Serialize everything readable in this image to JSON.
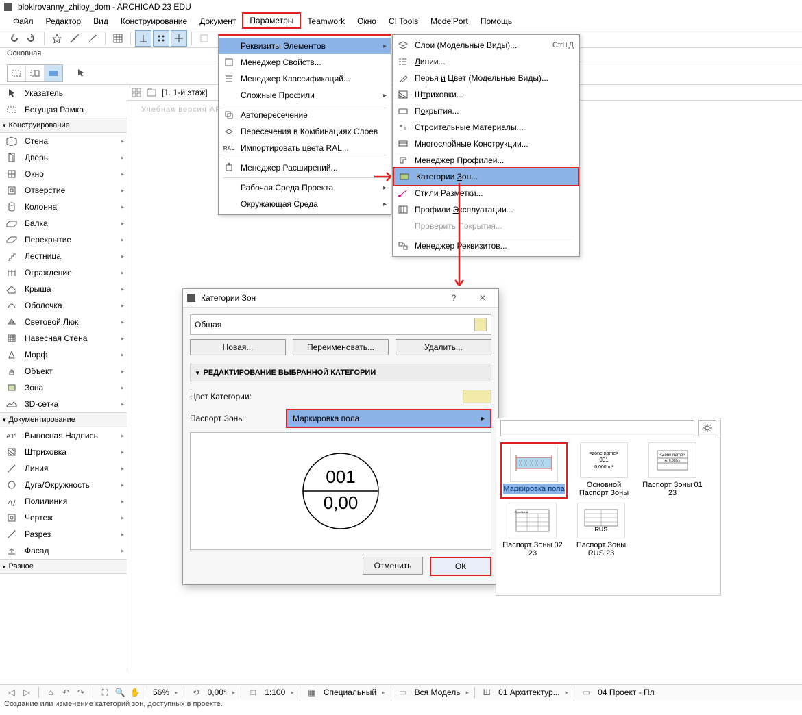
{
  "title": "blokirovanny_zhiloy_dom - ARCHICAD 23 EDU",
  "menubar": [
    "Файл",
    "Редактор",
    "Вид",
    "Конструирование",
    "Документ",
    "Параметры",
    "Teamwork",
    "Окно",
    "CI Tools",
    "ModelPort",
    "Помощь"
  ],
  "menubar_highlight_index": 5,
  "info_bar": "Основная",
  "tab_label": "[1. 1-й этаж]",
  "watermark": "Учебная версия ARCHI(",
  "dropdown": [
    {
      "label": "Реквизиты Элементов",
      "type": "sub",
      "hl": true
    },
    {
      "label": "Менеджер Свойств..."
    },
    {
      "label": "Менеджер Классификаций..."
    },
    {
      "label": "Сложные Профили",
      "type": "sub"
    },
    {
      "type": "sep"
    },
    {
      "label": "Автопересечение"
    },
    {
      "label": "Пересечения в Комбинациях Слоев"
    },
    {
      "label": "Импортировать цвета RAL..."
    },
    {
      "type": "sep"
    },
    {
      "label": "Менеджер Расширений..."
    },
    {
      "type": "sep"
    },
    {
      "label": "Рабочая Среда Проекта",
      "type": "sub"
    },
    {
      "label": "Окружающая Среда",
      "type": "sub"
    }
  ],
  "submenu": [
    {
      "label": "Слои (Модельные Виды)...",
      "accel": "Ctrl+Д"
    },
    {
      "label": "Линии..."
    },
    {
      "label": "Перья и Цвет (Модельные Виды)..."
    },
    {
      "label": "Штриховки..."
    },
    {
      "label": "Покрытия..."
    },
    {
      "label": "Строительные Материалы..."
    },
    {
      "label": "Многослойные Конструкции..."
    },
    {
      "label": "Менеджер Профилей..."
    },
    {
      "label": "Категории Зон...",
      "hl": true
    },
    {
      "label": "Стили Разметки..."
    },
    {
      "label": "Профили Эксплуатации..."
    },
    {
      "label": "Проверить Покрытия...",
      "disabled": true
    },
    {
      "type": "sep"
    },
    {
      "label": "Менеджер Реквизитов..."
    }
  ],
  "sections": {
    "design": "Конструирование",
    "document": "Документирование",
    "other": "Разное"
  },
  "tools_top": [
    "Указатель",
    "Бегущая Рамка"
  ],
  "tools_design": [
    "Стена",
    "Дверь",
    "Окно",
    "Отверстие",
    "Колонна",
    "Балка",
    "Перекрытие",
    "Лестница",
    "Ограждение",
    "Крыша",
    "Оболочка",
    "Световой Люк",
    "Навесная Стена",
    "Морф",
    "Объект",
    "Зона",
    "3D-сетка"
  ],
  "tools_doc": [
    "Выносная Надпись",
    "Штриховка",
    "Линия",
    "Дуга/Окружность",
    "Полилиния",
    "Чертеж",
    "Разрез",
    "Фасад"
  ],
  "dialog": {
    "title": "Категории Зон",
    "category_name": "Общая",
    "btn_new": "Новая...",
    "btn_rename": "Переименовать...",
    "btn_delete": "Удалить...",
    "section": "РЕДАКТИРОВАНИЕ ВЫБРАННОЙ КАТЕГОРИИ",
    "color_label": "Цвет Категории:",
    "stamp_label": "Паспорт Зоны:",
    "stamp_value": "Маркировка пола",
    "preview_top": "001",
    "preview_bottom": "0,00",
    "btn_cancel": "Отменить",
    "btn_ok": "ОК"
  },
  "stamp_picker": {
    "tiles": [
      {
        "label": "Маркировка пола",
        "sel": true
      },
      {
        "label": "Основной Паспорт Зоны"
      },
      {
        "label": "Паспорт Зоны 01 23"
      },
      {
        "label": "Паспорт Зоны 02 23"
      },
      {
        "label": "Паспорт Зоны RUS 23"
      }
    ]
  },
  "status": {
    "zoom": "56%",
    "angle": "0,00°",
    "scale": "1:100",
    "mode": "Специальный",
    "model": "Вся Модель",
    "layer": "01 Архитектур...",
    "project": "04 Проект - Пл"
  },
  "hint": "Создание или изменение категорий зон, доступных в проекте."
}
